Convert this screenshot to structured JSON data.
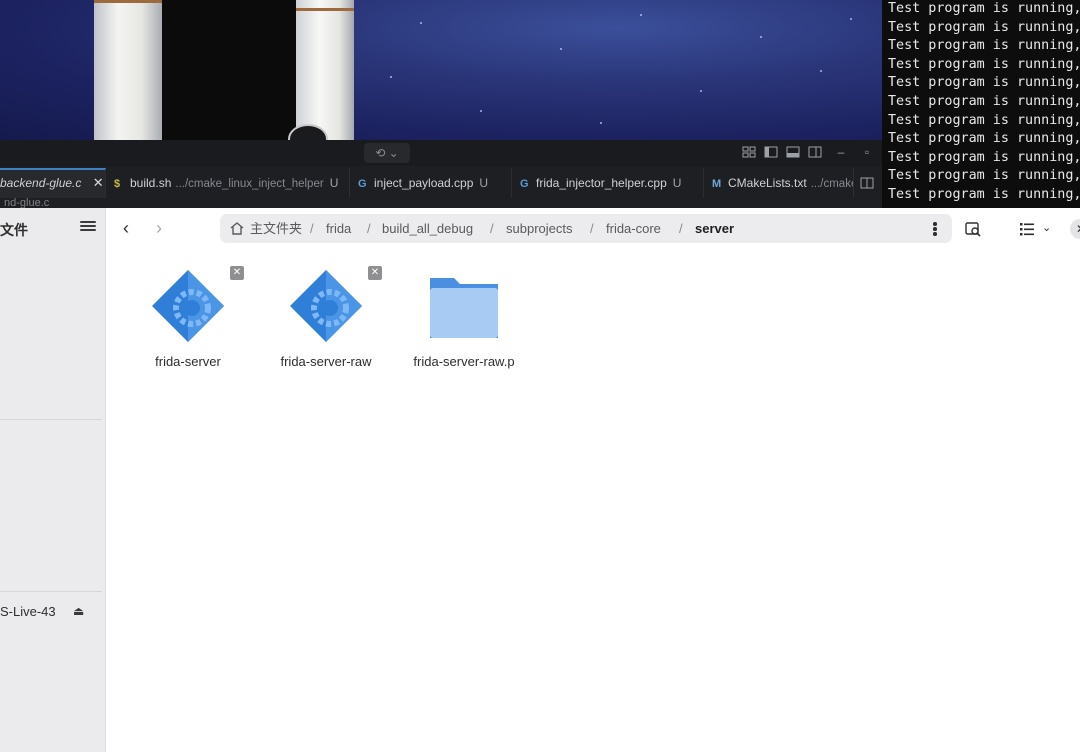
{
  "terminal": {
    "lines": [
      "Test program is running, p",
      "Test program is running, p",
      "Test program is running, p",
      "Test program is running, p",
      "Test program is running, p",
      "Test program is running, p",
      "Test program is running, p",
      "Test program is running, p",
      "Test program is running, p",
      "Test program is running, p",
      "Test program is running, p"
    ]
  },
  "ide": {
    "tabs": [
      {
        "icon": "",
        "name": "backend-glue.c",
        "path": "",
        "status": "",
        "close": "✕",
        "active": true
      },
      {
        "icon": "$",
        "name": "build.sh",
        "path": ".../cmake_linux_inject_helper",
        "status": "U",
        "close": "",
        "active": false
      },
      {
        "icon": "G",
        "name": "inject_payload.cpp",
        "path": "",
        "status": "U",
        "close": "",
        "active": false
      },
      {
        "icon": "G",
        "name": "frida_injector_helper.cpp",
        "path": "",
        "status": "U",
        "close": "",
        "active": false
      },
      {
        "icon": "M",
        "name": "CMakeLists.txt",
        "path": ".../cmake",
        "status": "",
        "close": "",
        "active": false
      }
    ],
    "breadcrumb": "nd-glue.c",
    "command_center_icon": "sync-icon"
  },
  "sidebar": {
    "title": "文件",
    "drive_label": "S-Live-43"
  },
  "header": {
    "back_icon": "‹",
    "forward_icon": "›",
    "path": {
      "home": "主文件夹",
      "segments": [
        "frida",
        "build_all_debug",
        "subprojects",
        "frida-core"
      ],
      "current": "server",
      "separator": "/"
    }
  },
  "files": [
    {
      "name": "frida-server",
      "type": "executable",
      "badge": "✕"
    },
    {
      "name": "frida-server-raw",
      "type": "executable",
      "badge": "✕"
    },
    {
      "name": "frida-server-raw.p",
      "type": "folder",
      "badge": ""
    }
  ],
  "colors": {
    "folder": "#5a9fe6",
    "executable": "#2f7ed8",
    "accent": "#3b82c4"
  }
}
